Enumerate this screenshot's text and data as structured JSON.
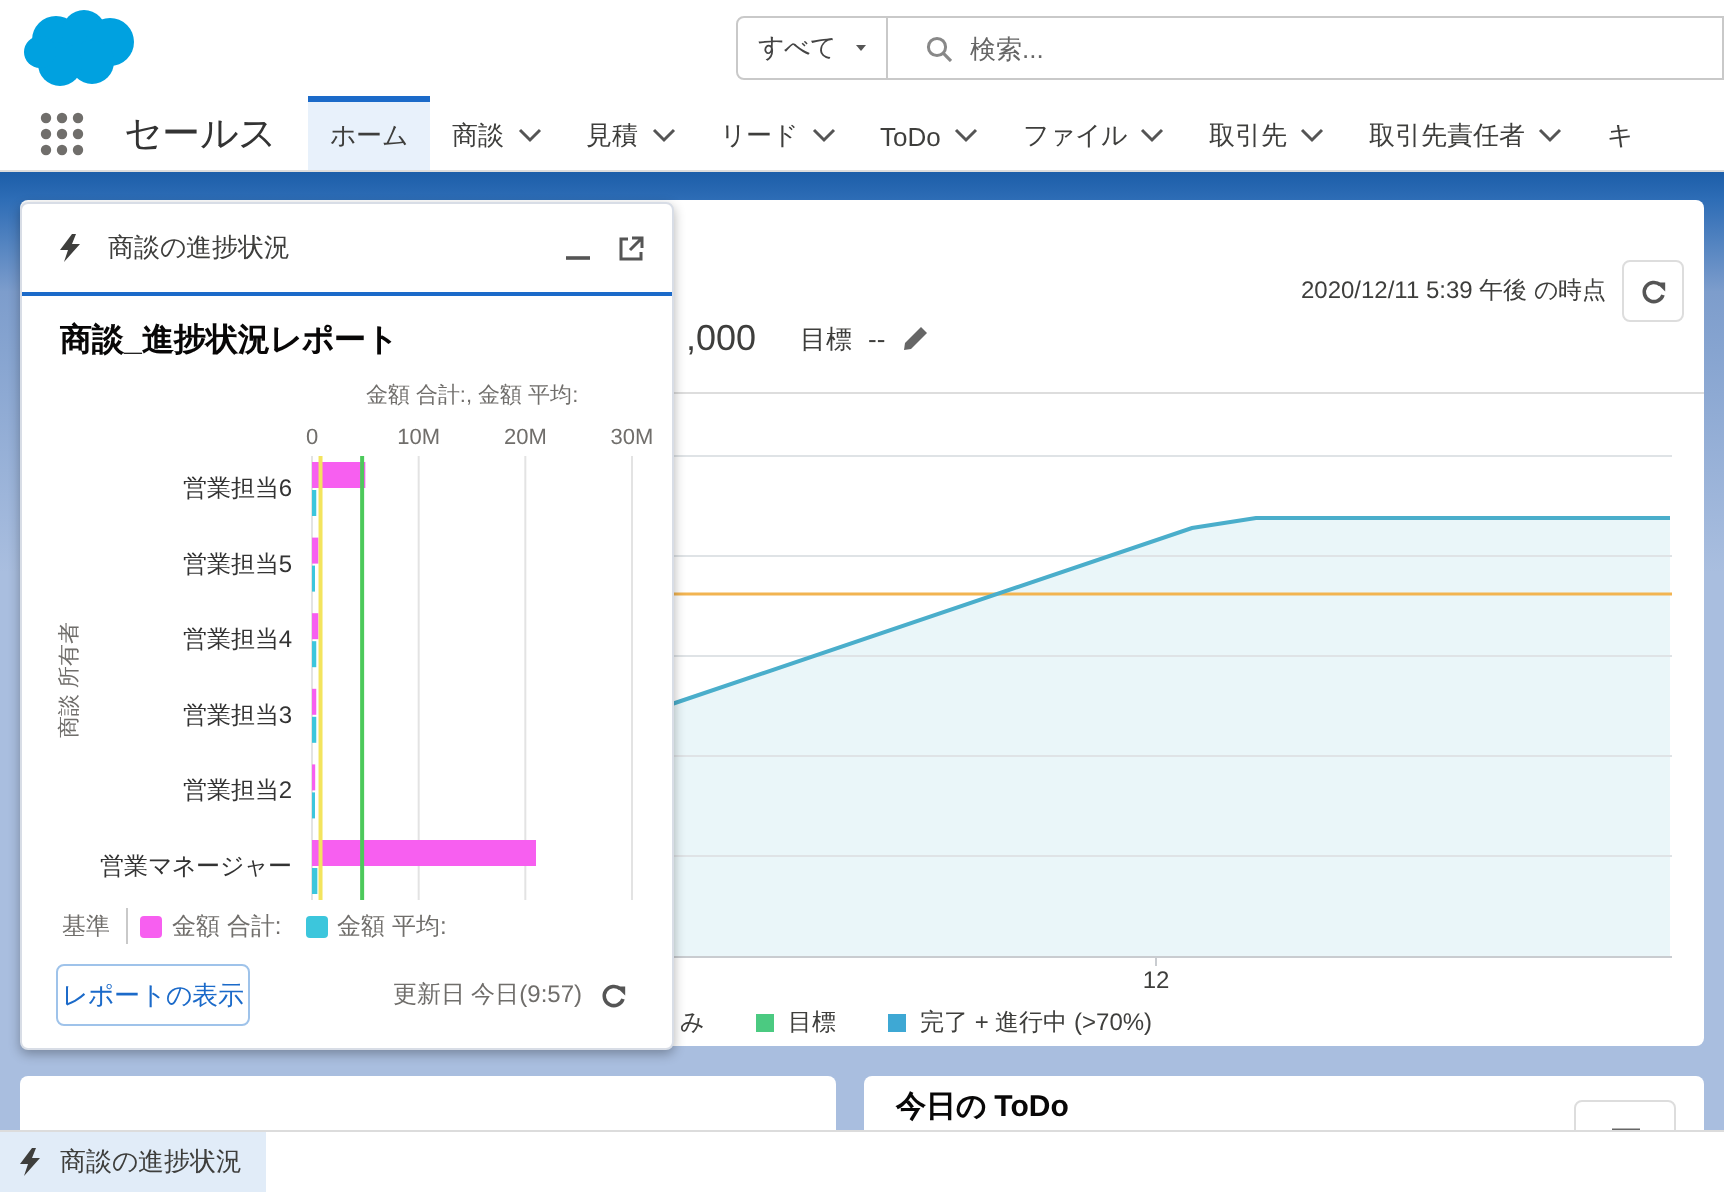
{
  "header": {
    "search_scope": "すべて",
    "search": {
      "placeholder": "検索..."
    }
  },
  "nav": {
    "app_name": "セールス",
    "tabs": [
      {
        "label": "ホーム",
        "selected": true,
        "dropdown": false
      },
      {
        "label": "商談",
        "selected": false,
        "dropdown": true
      },
      {
        "label": "見積",
        "selected": false,
        "dropdown": true
      },
      {
        "label": "リード",
        "selected": false,
        "dropdown": true
      },
      {
        "label": "ToDo",
        "selected": false,
        "dropdown": true
      },
      {
        "label": "ファイル",
        "selected": false,
        "dropdown": true
      },
      {
        "label": "取引先",
        "selected": false,
        "dropdown": true
      },
      {
        "label": "取引先責任者",
        "selected": false,
        "dropdown": true
      },
      {
        "label": "キ",
        "selected": false,
        "dropdown": false
      }
    ]
  },
  "dashboard": {
    "timestamp": "2020/12/11 5:39 午後 の時点",
    "amount": ",000",
    "goal_label": "目標",
    "goal_value": "--",
    "x_tick": "12",
    "legend": [
      {
        "label": "み"
      },
      {
        "label": "目標",
        "color": "#4bca81"
      },
      {
        "label": "完了 + 進行中 (>70%)",
        "color": "#3ea8d4"
      }
    ]
  },
  "todo_card": {
    "title": "今日の ToDo"
  },
  "panel": {
    "title": "商談の進捗状況",
    "report_title": "商談_進捗状況レポート",
    "chart_data": {
      "type": "bar",
      "orientation": "horizontal",
      "title": "金額 合計:, 金額 平均:",
      "ylabel": "商談 所有者",
      "categories": [
        "営業担当6",
        "営業担当5",
        "営業担当4",
        "営業担当3",
        "営業担当2",
        "営業マネージャー"
      ],
      "series": [
        {
          "name": "金額 合計:",
          "color": "#f75ff0",
          "values": [
            5000000,
            600000,
            600000,
            400000,
            300000,
            21000000
          ]
        },
        {
          "name": "金額 平均:",
          "color": "#3cc6dc",
          "values": [
            400000,
            100000,
            400000,
            400000,
            200000,
            500000
          ]
        }
      ],
      "xlim": [
        0,
        30000000
      ],
      "xticks": [
        {
          "value": 0,
          "label": "0"
        },
        {
          "value": 10000000,
          "label": "10M"
        },
        {
          "value": 20000000,
          "label": "20M"
        },
        {
          "value": 30000000,
          "label": "30M"
        }
      ],
      "ref_lines": [
        {
          "axis": "x",
          "value": 800000,
          "color": "#f3e45e"
        },
        {
          "axis": "x",
          "value": 4700000,
          "color": "#4cc95b"
        }
      ]
    },
    "baseline_label": "基準",
    "view_button": "レポートの表示",
    "updated": "更新日 今日(9:57)"
  },
  "utility_bar": {
    "items": [
      {
        "label": "商談の進捗状況",
        "selected": true
      }
    ]
  }
}
